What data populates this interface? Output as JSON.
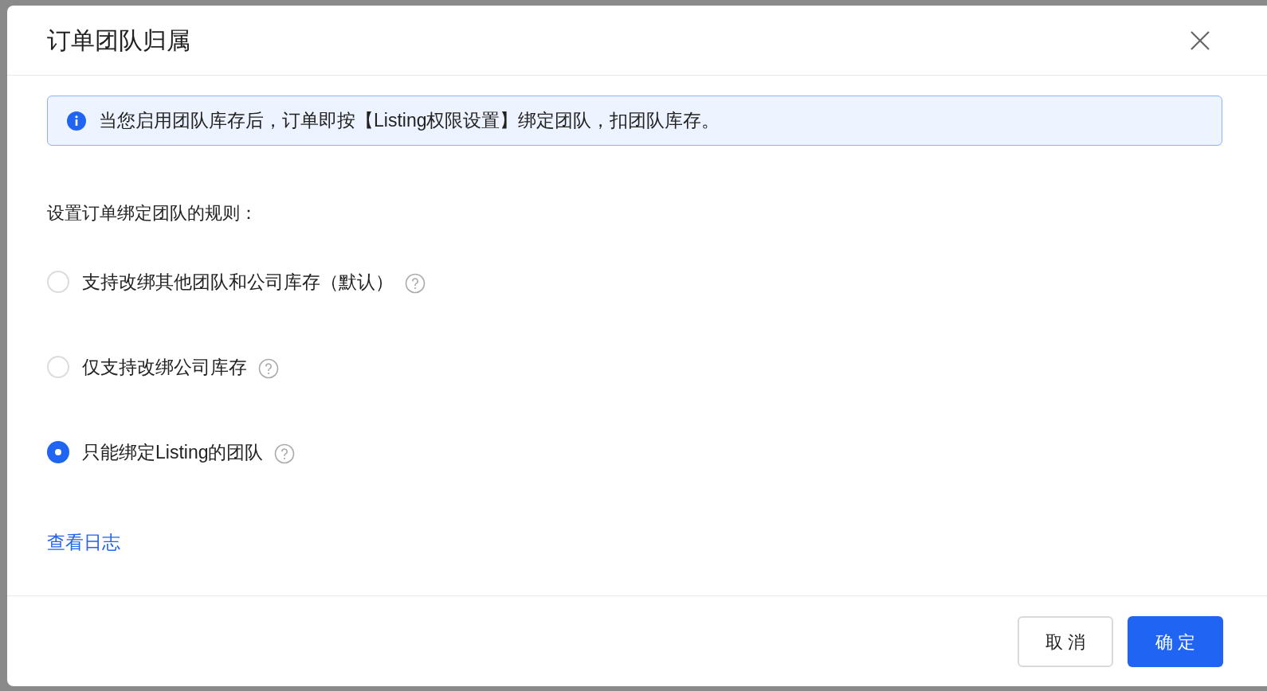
{
  "dialog": {
    "title": "订单团队归属",
    "alert": {
      "text": "当您启用团队库存后，订单即按【Listing权限设置】绑定团队，扣团队库存。"
    },
    "rule_label": "设置订单绑定团队的规则：",
    "options": [
      {
        "label": "支持改绑其他团队和公司库存（默认）",
        "selected": false
      },
      {
        "label": "仅支持改绑公司库存",
        "selected": false
      },
      {
        "label": "只能绑定Listing的团队",
        "selected": true
      }
    ],
    "log_link": "查看日志",
    "buttons": [
      {
        "label": "取 消",
        "kind": "default"
      },
      {
        "label": "确 定",
        "kind": "primary"
      }
    ]
  }
}
